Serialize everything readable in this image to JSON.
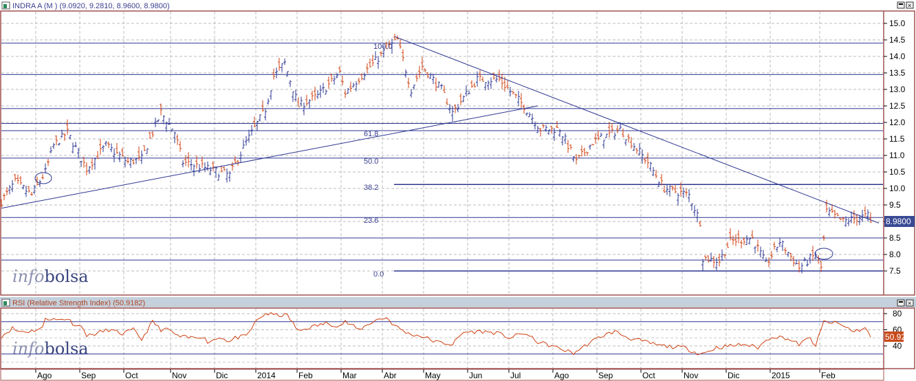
{
  "main_panel": {
    "title": "INDRA A (M ) (9.0920, 9.2810, 8.9600, 8.9800)",
    "last_price_label": "8.9800",
    "watermark_a": "info",
    "watermark_b": "bolsa"
  },
  "rsi_panel": {
    "title": "RSI (Relative Strength Index) (50.9182)",
    "last_value_label": "50.92"
  },
  "colors": {
    "up": "#2b3590",
    "down": "#d04010",
    "rsi": "#d04010",
    "lines": "#2b3590",
    "last_price_bg": "#3a4a95",
    "rsi_badge_bg": "#c84a1a"
  },
  "chart_data": [
    {
      "type": "ohlc",
      "title": "INDRA A (M )",
      "ylim": [
        7.0,
        15.5
      ],
      "yticks": [
        "15.0",
        "14.5",
        "14.0",
        "13.5",
        "13.0",
        "12.5",
        "12.0",
        "11.5",
        "11.0",
        "10.5",
        "10.0",
        "9.5",
        "9.0",
        "8.5",
        "8.0",
        "7.5"
      ],
      "last": {
        "open": 9.092,
        "high": 9.281,
        "low": 8.96,
        "close": 8.98
      },
      "price_path": [
        [
          0,
          9.6
        ],
        [
          5,
          10.2
        ],
        [
          11,
          9.8
        ],
        [
          16,
          10.5
        ],
        [
          19,
          11.3
        ],
        [
          24,
          11.7
        ],
        [
          31,
          10.6
        ],
        [
          38,
          11.3
        ],
        [
          46,
          10.8
        ],
        [
          51,
          10.9
        ],
        [
          58,
          12.3
        ],
        [
          63,
          11.7
        ],
        [
          66,
          10.8
        ],
        [
          75,
          10.6
        ],
        [
          83,
          10.4
        ],
        [
          89,
          11.4
        ],
        [
          96,
          12.4
        ],
        [
          99,
          13.4
        ],
        [
          103,
          13.8
        ],
        [
          108,
          12.5
        ],
        [
          115,
          12.8
        ],
        [
          123,
          13.5
        ],
        [
          125,
          12.9
        ],
        [
          133,
          13.6
        ],
        [
          141,
          14.3
        ],
        [
          144,
          14.5
        ],
        [
          149,
          13.0
        ],
        [
          153,
          13.7
        ],
        [
          160,
          13.0
        ],
        [
          164,
          12.3
        ],
        [
          173,
          13.3
        ],
        [
          181,
          13.3
        ],
        [
          190,
          12.5
        ],
        [
          196,
          11.8
        ],
        [
          203,
          11.8
        ],
        [
          209,
          10.8
        ],
        [
          215,
          11.4
        ],
        [
          225,
          11.8
        ],
        [
          235,
          10.8
        ],
        [
          241,
          10.0
        ],
        [
          250,
          9.8
        ],
        [
          254,
          9.0
        ],
        [
          255,
          7.9
        ],
        [
          261,
          7.8
        ],
        [
          265,
          8.4
        ],
        [
          273,
          8.5
        ],
        [
          278,
          7.7
        ],
        [
          283,
          8.4
        ],
        [
          290,
          7.6
        ],
        [
          296,
          8.0
        ],
        [
          298,
          7.6
        ],
        [
          300,
          9.3
        ],
        [
          306,
          9.0
        ],
        [
          316,
          9.2
        ]
      ],
      "horizontal_levels": [
        14.4,
        13.45,
        12.42,
        11.97,
        11.75,
        10.92,
        10.12,
        9.12,
        8.5,
        7.83,
        7.5
      ],
      "fibonacci_labels": [
        {
          "label": "100.0",
          "price": 14.4
        },
        {
          "label": "61.8",
          "price": 11.75
        },
        {
          "label": "50.0",
          "price": 10.92
        },
        {
          "label": "38.2",
          "price": 10.12
        },
        {
          "label": "23.6",
          "price": 9.12
        },
        {
          "label": "0.0",
          "price": 7.5
        }
      ],
      "trendlines": [
        {
          "from": [
            0,
            9.4
          ],
          "to": [
            195,
            12.5
          ]
        },
        {
          "from": [
            143,
            14.6
          ],
          "to": [
            319,
            8.95
          ]
        }
      ]
    },
    {
      "type": "line",
      "title": "RSI (Relative Strength Index)",
      "ylim": [
        20,
        90
      ],
      "yticks": [
        "80",
        "60",
        "40"
      ],
      "levels": [
        70,
        30
      ],
      "last": 50.9182,
      "rsi_path": [
        [
          0,
          52
        ],
        [
          4,
          62
        ],
        [
          6,
          58
        ],
        [
          10,
          58
        ],
        [
          15,
          62
        ],
        [
          16,
          75
        ],
        [
          20,
          72
        ],
        [
          24,
          74
        ],
        [
          26,
          68
        ],
        [
          30,
          62
        ],
        [
          31,
          52
        ],
        [
          34,
          55
        ],
        [
          39,
          60
        ],
        [
          44,
          55
        ],
        [
          48,
          60
        ],
        [
          51,
          48
        ],
        [
          55,
          70
        ],
        [
          58,
          60
        ],
        [
          61,
          60
        ],
        [
          64,
          52
        ],
        [
          68,
          50
        ],
        [
          73,
          52
        ],
        [
          75,
          45
        ],
        [
          80,
          51
        ],
        [
          83,
          45
        ],
        [
          85,
          50
        ],
        [
          89,
          52
        ],
        [
          93,
          72
        ],
        [
          96,
          80
        ],
        [
          100,
          78
        ],
        [
          104,
          78
        ],
        [
          108,
          58
        ],
        [
          111,
          62
        ],
        [
          118,
          68
        ],
        [
          123,
          65
        ],
        [
          125,
          70
        ],
        [
          130,
          60
        ],
        [
          136,
          72
        ],
        [
          140,
          75
        ],
        [
          143,
          65
        ],
        [
          148,
          55
        ],
        [
          153,
          52
        ],
        [
          158,
          45
        ],
        [
          164,
          42
        ],
        [
          168,
          57
        ],
        [
          175,
          58
        ],
        [
          180,
          56
        ],
        [
          185,
          50
        ],
        [
          190,
          56
        ],
        [
          195,
          45
        ],
        [
          200,
          40
        ],
        [
          208,
          31
        ],
        [
          213,
          42
        ],
        [
          218,
          52
        ],
        [
          223,
          58
        ],
        [
          228,
          50
        ],
        [
          234,
          45
        ],
        [
          240,
          40
        ],
        [
          248,
          38
        ],
        [
          254,
          30
        ],
        [
          256,
          32
        ],
        [
          260,
          38
        ],
        [
          265,
          40
        ],
        [
          270,
          42
        ],
        [
          275,
          38
        ],
        [
          280,
          52
        ],
        [
          285,
          50
        ],
        [
          290,
          42
        ],
        [
          294,
          50
        ],
        [
          296,
          40
        ],
        [
          299,
          70
        ],
        [
          304,
          68
        ],
        [
          310,
          58
        ],
        [
          314,
          62
        ],
        [
          316,
          52
        ]
      ]
    }
  ],
  "x_axis": {
    "months": [
      {
        "label": "Ago",
        "bar": 15
      },
      {
        "label": "Sep",
        "bar": 31
      },
      {
        "label": "Oct",
        "bar": 47
      },
      {
        "label": "Nov",
        "bar": 64
      },
      {
        "label": "Dic",
        "bar": 80
      },
      {
        "label": "2014",
        "bar": 95
      },
      {
        "label": "Feb",
        "bar": 110
      },
      {
        "label": "Mar",
        "bar": 126
      },
      {
        "label": "Abr",
        "bar": 141
      },
      {
        "label": "May",
        "bar": 156
      },
      {
        "label": "Jun",
        "bar": 172
      },
      {
        "label": "Jul",
        "bar": 187
      },
      {
        "label": "Ago",
        "bar": 203
      },
      {
        "label": "Sep",
        "bar": 219
      },
      {
        "label": "Oct",
        "bar": 235
      },
      {
        "label": "Nov",
        "bar": 250
      },
      {
        "label": "Dic",
        "bar": 266
      },
      {
        "label": "2015",
        "bar": 282
      },
      {
        "label": "Feb",
        "bar": 300
      }
    ]
  }
}
